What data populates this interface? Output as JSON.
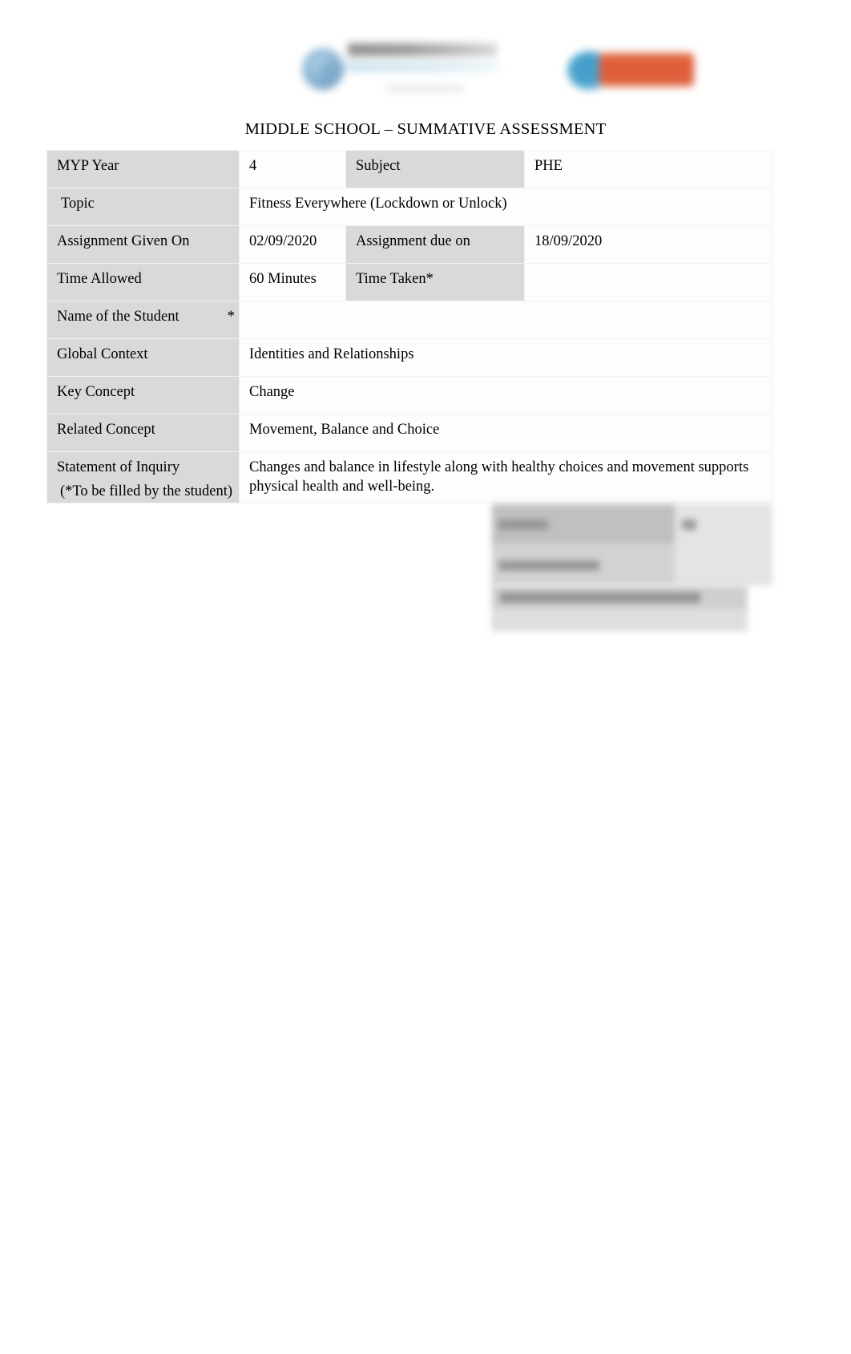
{
  "header": {
    "left_logo": {
      "name": "school-logo",
      "description": "blurred school crest with wordmark",
      "mark_color": "#8fb8d6",
      "wordmark_color": "#9a9a9a",
      "tagline_color": "#dcebf2"
    },
    "right_logo": {
      "name": "ib-world-school-logo",
      "description": "blurred blue circle with orange banner",
      "circle_color": "#4ea4cd",
      "banner_color": "#de5a36"
    }
  },
  "document": {
    "title": "MIDDLE SCHOOL  – SUMMATIVE ASSESSMENT",
    "footnote": "(*To be filled by the student)"
  },
  "info_table": {
    "rows": [
      {
        "label": "MYP Year",
        "value": "4",
        "label2": "Subject",
        "value2": "PHE",
        "label_shaded": true,
        "label2_shaded": true
      },
      {
        "label": " Topic",
        "value": "Fitness Everywhere (Lockdown or Unlock)",
        "label2": "",
        "value2": "",
        "label_shaded": true,
        "label2_shaded": false,
        "span_value": true
      },
      {
        "label": "Assignment Given On",
        "value": "02/09/2020",
        "label2": "Assignment due on",
        "value2": "18/09/2020",
        "label_shaded": true,
        "label2_shaded": true
      },
      {
        "label": "Time Allowed",
        "value": "60 Minutes",
        "label2": "Time Taken*",
        "value2": "",
        "label_shaded": true,
        "label2_shaded": true
      },
      {
        "label": "Name of the Student",
        "label_suffix": "*",
        "value": "",
        "label2": "",
        "value2": "",
        "label_shaded": true,
        "label2_shaded": false,
        "span_value": true
      },
      {
        "label": "Global Context",
        "value": "Identities and Relationships",
        "label2": "",
        "value2": "",
        "label_shaded": true,
        "label2_shaded": false,
        "span_value": true
      },
      {
        "label": "Key Concept",
        "value": "Change",
        "label2": "",
        "value2": "",
        "label_shaded": true,
        "label2_shaded": false,
        "span_value": true
      },
      {
        "label": "Related Concept",
        "value": "Movement, Balance and Choice",
        "label2": "",
        "value2": "",
        "label_shaded": true,
        "label2_shaded": false,
        "span_value": true
      },
      {
        "label": "Statement of Inquiry",
        "value": "Changes and balance in lifestyle along with healthy choices and movement supports physical health and well-being.",
        "label2": "",
        "value2": "",
        "label_shaded": true,
        "label2_shaded": false,
        "span_value": true
      }
    ]
  },
  "redacted": {
    "block1": {
      "name": "criteria-marks-table",
      "description": "blurred two-row grading table with label and mark columns",
      "illegible": true
    },
    "block2": {
      "name": "teacher-comment-row",
      "description": "blurred comment banner row",
      "illegible": true
    }
  },
  "colors": {
    "page_background": "#ffffff",
    "label_shade": "#d9d9d9",
    "cell_border": "#f2f2f2",
    "text": "#000000"
  }
}
